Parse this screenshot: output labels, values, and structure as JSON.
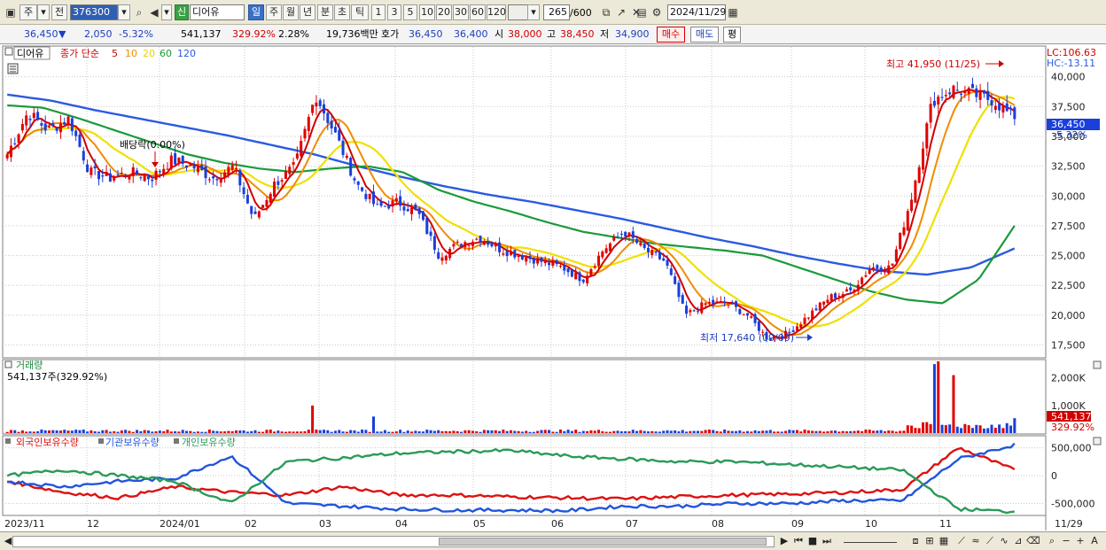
{
  "toolbar": {
    "market_label": "주",
    "prev_label": "전",
    "code": "376300",
    "new_badge": "신",
    "stock_name": "디어유",
    "periods": [
      "일",
      "주",
      "월",
      "년",
      "분",
      "초",
      "틱"
    ],
    "selected_period": "일",
    "intervals": [
      "1",
      "3",
      "5",
      "10",
      "20",
      "30",
      "60",
      "120"
    ],
    "count": "265",
    "count_total": "/600",
    "date": "2024/11/29"
  },
  "quote": {
    "price": "36,450",
    "direction": "▼",
    "change": "2,050",
    "change_pct": "-5.32%",
    "volume": "541,137",
    "volume_ratio": "329.92%",
    "turnover": "2.28%",
    "amount": "19,736백만",
    "bid_label": "호가",
    "bid1": "36,450",
    "bid2": "36,400",
    "open_label": "시",
    "open": "38,000",
    "high_label": "고",
    "high": "38,450",
    "low_label": "저",
    "low": "34,900",
    "buy_label": "매수",
    "sell_label": "매도",
    "eval_label": "평"
  },
  "price_panel": {
    "name": "디어유",
    "legend_label": "종가 단순",
    "ma_labels": [
      "5",
      "10",
      "20",
      "60",
      "120"
    ],
    "lc": "LC:106.63",
    "hc": "HC:-13.11",
    "current_price_tag": "36,450",
    "current_pct_tag": "-5.32%",
    "high_annotation": "최고 41,950 (11/25)",
    "low_annotation": "최저 17,640 (09/09)",
    "dividend_annotation": "배당락(0.00%)"
  },
  "volume_panel": {
    "title": "거래량",
    "value": "541,137주(329.92%)",
    "axis_ticks": [
      "2,000K",
      "1,000K"
    ],
    "current_tag": "541,137",
    "current_pct_tag": "329.92%"
  },
  "holdings_panel": {
    "legend": [
      "외국인보유수량",
      "기관보유수량",
      "개인보유수량"
    ],
    "axis_ticks": [
      "500,000",
      "0",
      "-500,000"
    ]
  },
  "x_axis": {
    "labels": [
      "2023/11",
      "12",
      "2024/01",
      "02",
      "03",
      "04",
      "05",
      "06",
      "07",
      "08",
      "09",
      "10",
      "11",
      "11/29"
    ]
  },
  "colors": {
    "up": "#e00000",
    "down": "#1a3fdb",
    "ma5": "#d00000",
    "ma10": "#f08c00",
    "ma20": "#f0e000",
    "ma60": "#1a9a3a",
    "ma120": "#2a5be0",
    "foreign": "#dd1111",
    "institution": "#2255dd",
    "individual": "#2a9a5a"
  },
  "chart_data": [
    {
      "type": "candlestick",
      "title": "디어유",
      "x": [
        "2023/11",
        "12",
        "2024/01",
        "02",
        "03",
        "04",
        "05",
        "06",
        "07",
        "08",
        "09",
        "10",
        "11",
        "11/29"
      ],
      "ylim": [
        16500,
        42500
      ],
      "y_ticks": [
        17500,
        20000,
        22500,
        25000,
        27500,
        30000,
        32500,
        35000,
        37500,
        40000
      ],
      "close_path": [
        33500,
        37000,
        35500,
        36500,
        32000,
        31500,
        32000,
        31500,
        33000,
        32500,
        31500,
        32500,
        28000,
        31000,
        32500,
        38500,
        35000,
        31000,
        29000,
        29500,
        28500,
        25000,
        26000,
        26500,
        25500,
        25000,
        24500,
        24000,
        23000,
        25500,
        27000,
        25500,
        24500,
        20000,
        21000,
        21000,
        20000,
        18000,
        18500,
        20000,
        21500,
        22000,
        24000,
        24000,
        30000,
        38000,
        39000,
        38500,
        38000,
        36450
      ],
      "ma60_path": [
        37600,
        37400,
        36500,
        35500,
        34500,
        33500,
        32800,
        32300,
        32000,
        32300,
        32500,
        32000,
        30500,
        29500,
        28700,
        27800,
        27000,
        26500,
        26000,
        25700,
        25400,
        25000,
        24000,
        23000,
        22000,
        21300,
        21000,
        23000,
        27500
      ],
      "ma120_path": [
        38500,
        38000,
        37200,
        36500,
        35800,
        35100,
        34300,
        33500,
        32500,
        31600,
        30800,
        30100,
        29500,
        28800,
        28100,
        27300,
        26500,
        25800,
        25000,
        24300,
        23700,
        23400,
        24000,
        25600
      ],
      "high": {
        "value": 41950,
        "date": "11/25"
      },
      "low": {
        "value": 17640,
        "date": "09/09"
      },
      "last": 36450
    },
    {
      "type": "bar",
      "title": "거래량",
      "ylim": [
        0,
        2600000
      ],
      "y_ticks": [
        1000000,
        2000000
      ],
      "spikes": [
        {
          "x": "03",
          "value": 1000000
        },
        {
          "x": "11",
          "value": 2500000
        },
        {
          "x": "11",
          "value": 2100000
        }
      ],
      "last": 541137
    },
    {
      "type": "line",
      "title": "보유수량",
      "ylim": [
        -700000,
        700000
      ],
      "y_ticks": [
        500000,
        0,
        -500000
      ],
      "series": [
        {
          "name": "외국인보유수량",
          "values": [
            -100000,
            -300000,
            -400000,
            -200000,
            -300000,
            -350000,
            -200000,
            -350000,
            -350000,
            -380000,
            -400000,
            -420000,
            -380000,
            -350000,
            -330000,
            -300000,
            -250000,
            500000,
            100000
          ]
        },
        {
          "name": "기관보유수량",
          "values": [
            -100000,
            -200000,
            -100000,
            -50000,
            350000,
            -500000,
            -550000,
            -600000,
            -620000,
            -620000,
            -630000,
            -550000,
            -550000,
            -500000,
            -500000,
            -450000,
            -450000,
            300000,
            550000
          ]
        },
        {
          "name": "개인보유수량",
          "values": [
            0,
            100000,
            0,
            -100000,
            -500000,
            250000,
            320000,
            400000,
            430000,
            450000,
            350000,
            300000,
            250000,
            250000,
            200000,
            150000,
            100000,
            -600000,
            -650000
          ]
        }
      ]
    }
  ]
}
